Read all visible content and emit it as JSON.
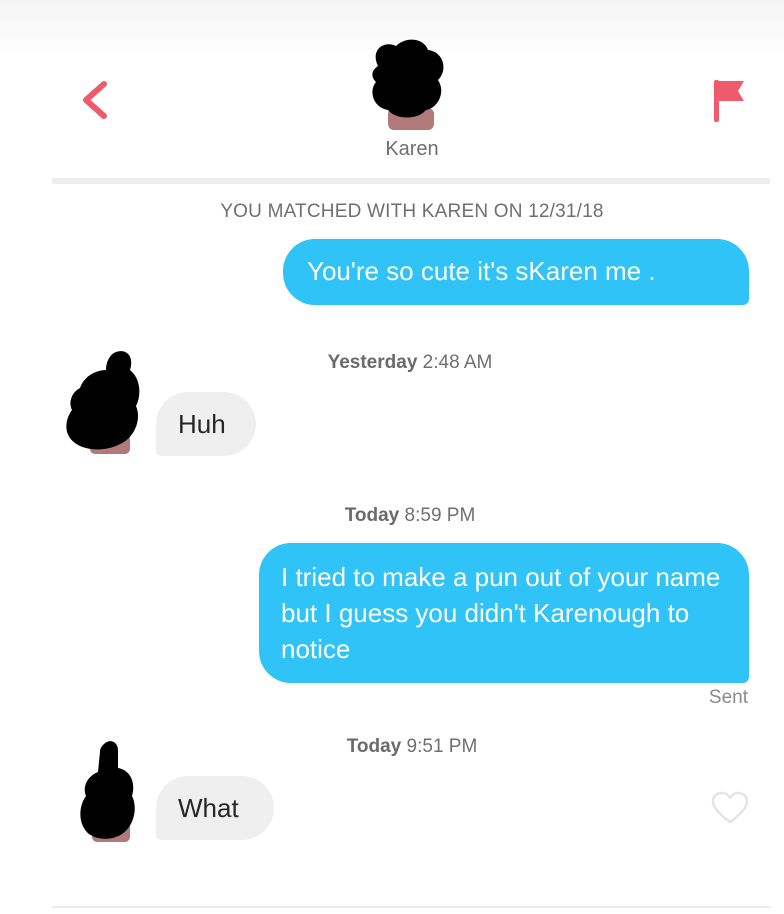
{
  "header": {
    "back_icon": "chevron-left-icon",
    "flag_icon": "flag-icon",
    "match_name": "Karen",
    "accent_color": "#f05a6d"
  },
  "conversation": {
    "match_notice": "YOU MATCHED WITH KAREN ON 12/31/18",
    "messages": [
      {
        "direction": "sent",
        "text": "You're so cute it's sKaren me ."
      },
      {
        "stamp_day": "Yesterday",
        "stamp_time": "2:48 AM",
        "direction": "received",
        "text": "Huh"
      },
      {
        "stamp_day": "Today",
        "stamp_time": "8:59 PM",
        "direction": "sent",
        "text": "I tried to make a pun out of your name but I guess you didn't Karenough to notice",
        "status": "Sent"
      },
      {
        "stamp_day": "Today",
        "stamp_time": "9:51 PM",
        "direction": "received",
        "text": "What"
      }
    ],
    "like_icon": "heart-outline-icon",
    "sent_bubble_color": "#2fc3f7",
    "received_bubble_color": "#efefef"
  }
}
